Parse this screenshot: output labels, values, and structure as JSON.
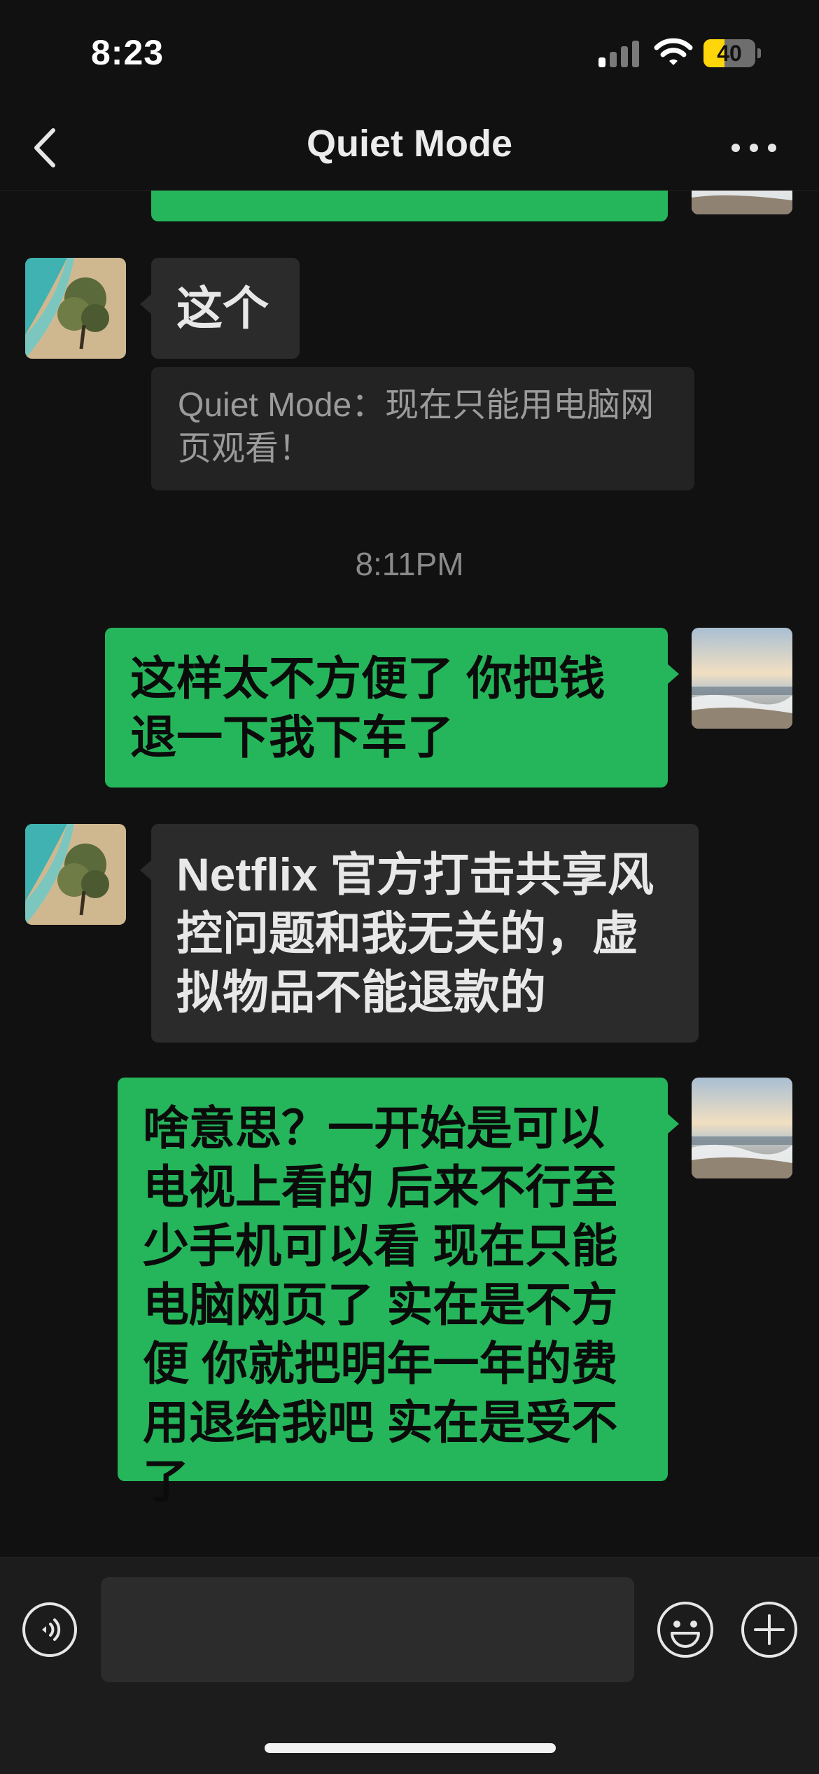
{
  "status_bar": {
    "time": "8:23",
    "battery_level": "40",
    "battery_fraction": 0.4,
    "battery_color": "#ffd60a",
    "signal_bars_active": 1,
    "signal_bars_total": 4
  },
  "nav": {
    "title": "Quiet Mode",
    "back_icon": "chevron-left-icon",
    "more_icon": "ellipsis-icon"
  },
  "messages": [
    {
      "side": "right",
      "type": "text",
      "text": "……",
      "partially_visible": true
    },
    {
      "side": "left",
      "type": "text",
      "text": "这个"
    },
    {
      "side": "left",
      "type": "quote",
      "text": "Quiet Mode：现在只能用电脑网页观看！"
    },
    {
      "type": "timestamp",
      "text": "8:11PM"
    },
    {
      "side": "right",
      "type": "text",
      "text": "这样太不方便了 你把钱退一下我下车了"
    },
    {
      "side": "left",
      "type": "text",
      "text": "Netflix 官方打击共享风控问题和我无关的，虚拟物品不能退款的"
    },
    {
      "side": "right",
      "type": "text",
      "text": "啥意思？一开始是可以电视上看的 后来不行至少手机可以看 现在只能电脑网页了 实在是不方便 你就把明年一年的费用退给我吧 实在是受不了"
    }
  ],
  "input_bar": {
    "voice_icon": "voice-icon",
    "input_value": "",
    "emoji_icon": "emoji-icon",
    "plus_icon": "plus-icon"
  },
  "colors": {
    "background": "#111111",
    "outgoing_bubble": "#25b65b",
    "incoming_bubble": "#2b2b2b",
    "quote_bubble": "#232323"
  }
}
